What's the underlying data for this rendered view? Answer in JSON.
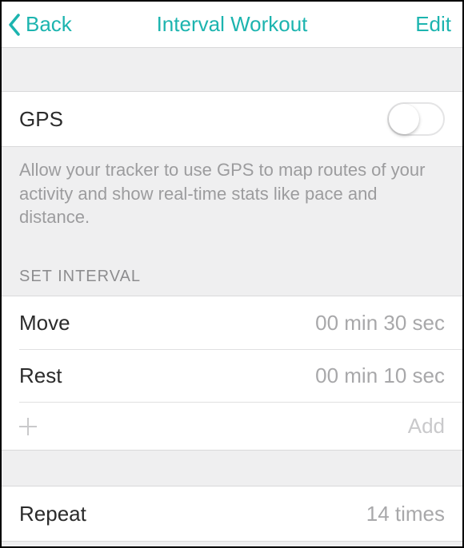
{
  "nav": {
    "back": "Back",
    "title": "Interval Workout",
    "edit": "Edit"
  },
  "gps": {
    "label": "GPS",
    "on": false,
    "description": "Allow your tracker to use GPS to map routes of your activity and show real-time stats like pace and distance."
  },
  "set_interval": {
    "header": "SET INTERVAL",
    "items": [
      {
        "label": "Move",
        "value": "00 min 30 sec"
      },
      {
        "label": "Rest",
        "value": "00 min 10 sec"
      }
    ],
    "add_label": "Add"
  },
  "repeat": {
    "label": "Repeat",
    "value": "14 times"
  }
}
